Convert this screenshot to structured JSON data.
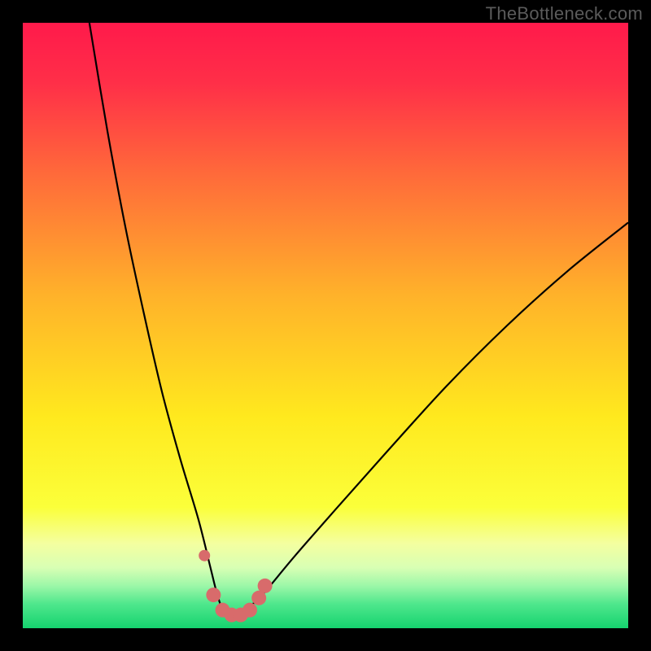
{
  "watermark": "TheBottleneck.com",
  "chart_data": {
    "type": "line",
    "title": "",
    "xlabel": "",
    "ylabel": "",
    "xlim": [
      0,
      100
    ],
    "ylim": [
      0,
      100
    ],
    "grid": false,
    "legend": false,
    "background_gradient": [
      {
        "offset": 0.0,
        "color": "#ff1a4b"
      },
      {
        "offset": 0.1,
        "color": "#ff2f48"
      },
      {
        "offset": 0.25,
        "color": "#ff6a3a"
      },
      {
        "offset": 0.45,
        "color": "#ffb22a"
      },
      {
        "offset": 0.65,
        "color": "#ffe91e"
      },
      {
        "offset": 0.8,
        "color": "#fbff3a"
      },
      {
        "offset": 0.86,
        "color": "#f4ffa0"
      },
      {
        "offset": 0.9,
        "color": "#d8ffb4"
      },
      {
        "offset": 0.93,
        "color": "#9cf7a8"
      },
      {
        "offset": 0.96,
        "color": "#4fe78c"
      },
      {
        "offset": 1.0,
        "color": "#15d36f"
      }
    ],
    "series": [
      {
        "name": "bottleneck-curve",
        "stroke": "#000000",
        "x": [
          11,
          14,
          17,
          20,
          23,
          26,
          29,
          31,
          32,
          33,
          34,
          35,
          36,
          37,
          38,
          40,
          45,
          52,
          60,
          70,
          80,
          90,
          100
        ],
        "values": [
          100,
          82,
          66,
          52,
          39,
          28,
          18,
          10,
          6,
          3,
          2,
          2,
          2,
          3,
          4,
          6,
          12,
          20,
          29,
          40,
          50,
          59,
          67
        ]
      }
    ],
    "markers": {
      "name": "optimum-band",
      "color": "#d86b6b",
      "radius_main": 9,
      "radius_small": 7,
      "points": [
        {
          "x": 30.0,
          "y": 12.0,
          "r": 7
        },
        {
          "x": 31.5,
          "y": 5.5,
          "r": 9
        },
        {
          "x": 33.0,
          "y": 3.0,
          "r": 9
        },
        {
          "x": 34.5,
          "y": 2.2,
          "r": 9
        },
        {
          "x": 36.0,
          "y": 2.2,
          "r": 9
        },
        {
          "x": 37.5,
          "y": 3.0,
          "r": 9
        },
        {
          "x": 39.0,
          "y": 5.0,
          "r": 9
        },
        {
          "x": 40.0,
          "y": 7.0,
          "r": 9
        }
      ]
    }
  }
}
